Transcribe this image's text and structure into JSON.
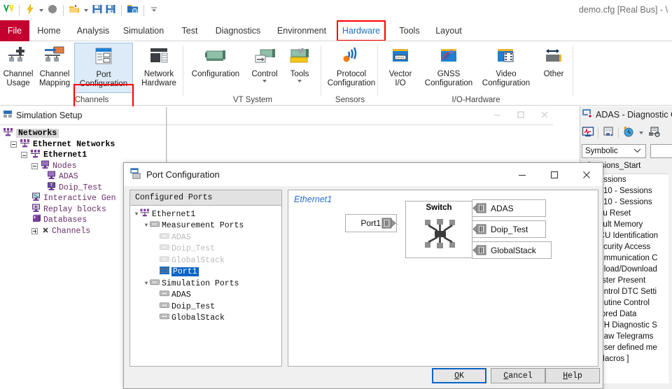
{
  "window": {
    "title": "demo.cfg [Real Bus] - \\"
  },
  "quick_access": {
    "icons": [
      "vector-logo-icon",
      "lightning-icon",
      "dropdown-caret-icon",
      "stop-circle-icon",
      "open-folder-icon",
      "dropdown-caret-icon",
      "save-icon",
      "save-as-icon",
      "config-folder-icon",
      "customize-qat-icon"
    ]
  },
  "ribbon": {
    "tabs": [
      {
        "label": "File",
        "active": false
      },
      {
        "label": "Home",
        "active": false
      },
      {
        "label": "Analysis",
        "active": false
      },
      {
        "label": "Simulation",
        "active": false
      },
      {
        "label": "Test",
        "active": false
      },
      {
        "label": "Diagnostics",
        "active": false
      },
      {
        "label": "Environment",
        "active": false
      },
      {
        "label": "Hardware",
        "active": true
      },
      {
        "label": "Tools",
        "active": false
      },
      {
        "label": "Layout",
        "active": false
      }
    ],
    "highlight_color": "#ff0000",
    "active_tab_color": "#1f6fc4",
    "file_tab_color": "#c3002f",
    "groups": [
      {
        "label": "Channels",
        "buttons": [
          {
            "label": "Channel\nUsage",
            "line1": "Channel",
            "line2": "Usage",
            "icon": "channel-usage-icon",
            "selected": false,
            "has_caret": false
          },
          {
            "label": "Channel\nMapping",
            "line1": "Channel",
            "line2": "Mapping",
            "icon": "channel-mapping-icon",
            "selected": false,
            "has_caret": false
          },
          {
            "label": "Port\nConfiguration",
            "line1": "Port",
            "line2": "Configuration",
            "icon": "port-configuration-icon",
            "selected": true,
            "has_caret": false
          },
          {
            "label": "Network\nHardware",
            "line1": "Network",
            "line2": "Hardware",
            "icon": "network-hardware-icon",
            "selected": false,
            "has_caret": false
          }
        ]
      },
      {
        "label": "VT System",
        "buttons": [
          {
            "line1": "Configuration",
            "line2": "",
            "icon": "vt-configuration-icon",
            "selected": false,
            "has_caret": false
          },
          {
            "line1": "Control",
            "line2": "",
            "icon": "vt-control-icon",
            "selected": false,
            "has_caret": true
          },
          {
            "line1": "Tools",
            "line2": "",
            "icon": "vt-tools-icon",
            "selected": false,
            "has_caret": true
          }
        ]
      },
      {
        "label": "Sensors",
        "buttons": [
          {
            "line1": "Protocol",
            "line2": "Configuration",
            "icon": "protocol-configuration-icon",
            "selected": false,
            "has_caret": false
          }
        ]
      },
      {
        "label": "I/O-Hardware",
        "buttons": [
          {
            "line1": "Vector",
            "line2": "I/O",
            "icon": "vector-io-icon",
            "selected": false,
            "has_caret": false
          },
          {
            "line1": "GNSS",
            "line2": "Configuration",
            "icon": "gnss-configuration-icon",
            "selected": false,
            "has_caret": false
          },
          {
            "line1": "Video",
            "line2": "Configuration",
            "icon": "video-configuration-icon",
            "selected": false,
            "has_caret": false
          },
          {
            "line1": "Other",
            "line2": "",
            "icon": "other-hardware-icon",
            "selected": false,
            "has_caret": false
          }
        ]
      }
    ]
  },
  "simulation_setup": {
    "title": "Simulation Setup",
    "icon": "simulation-setup-icon",
    "window_buttons": [
      "minimize",
      "maximize",
      "close"
    ],
    "tree": [
      {
        "label": "Networks",
        "indent": 0,
        "icon": "networks-icon",
        "expander": "none",
        "bold": true,
        "selected": true
      },
      {
        "label": "Ethernet Networks",
        "indent": 1,
        "icon": "networks-icon",
        "expander": "minus",
        "bold": true,
        "selected": false
      },
      {
        "label": "Ethernet1",
        "indent": 2,
        "icon": "networks-icon",
        "expander": "minus",
        "bold": true,
        "selected": false
      },
      {
        "label": "Nodes",
        "indent": 3,
        "icon": "node-icon",
        "expander": "minus",
        "bold": false,
        "selected": false
      },
      {
        "label": "ADAS",
        "indent": 4,
        "icon": "node-icon",
        "expander": "none",
        "bold": false,
        "selected": false
      },
      {
        "label": "Doip_Test",
        "indent": 4,
        "icon": "node-doip-icon",
        "expander": "none",
        "bold": false,
        "selected": false
      },
      {
        "label": "Interactive Gen",
        "indent": 3,
        "icon": "igen-icon",
        "expander": "none",
        "bold": false,
        "selected": false
      },
      {
        "label": "Replay blocks",
        "indent": 3,
        "icon": "replay-icon",
        "expander": "none",
        "bold": false,
        "selected": false
      },
      {
        "label": "Databases",
        "indent": 3,
        "icon": "database-icon",
        "expander": "none",
        "bold": false,
        "selected": false
      },
      {
        "label": "Channels",
        "indent": 3,
        "icon": "channels-icon",
        "expander": "plus",
        "bold": false,
        "selected": false
      }
    ]
  },
  "diagnostic_panel": {
    "title": "ADAS - Diagnostic C",
    "icon": "diagnostic-console-icon",
    "toolbar": [
      "trace-window-icon",
      "copy-to-icon",
      "history-icon",
      "history-caret-icon",
      "settings-icon"
    ],
    "mode_select": {
      "value": "Symbolic",
      "options": [
        "Symbolic"
      ]
    },
    "text_field_value": "",
    "session_label": "- Sessions_Start",
    "items": [
      {
        "label": "Sessions",
        "sub": false,
        "icon": "folder-service-icon"
      },
      {
        "label": "10 - Sessions",
        "sub": true,
        "icon": "request-icon"
      },
      {
        "label": "10 - Sessions",
        "sub": true,
        "icon": "request-icon"
      },
      {
        "label": "Ecu Reset",
        "sub": false,
        "icon": "folder-service-icon"
      },
      {
        "label": "Fault Memory",
        "sub": false,
        "icon": "folder-service-icon"
      },
      {
        "label": "ECU Identification",
        "sub": false,
        "icon": "folder-service-icon"
      },
      {
        "label": "Security Access",
        "sub": false,
        "icon": "folder-service-icon"
      },
      {
        "label": "Communication C",
        "sub": false,
        "icon": "folder-service-icon"
      },
      {
        "label": "Upload/Download",
        "sub": false,
        "icon": "folder-service-icon"
      },
      {
        "label": "Tester Present",
        "sub": false,
        "icon": "folder-service-icon"
      },
      {
        "label": "Control DTC Setti",
        "sub": false,
        "icon": "folder-service-icon"
      },
      {
        "label": "Routine Control",
        "sub": false,
        "icon": "folder-service-icon"
      },
      {
        "label": "Stored Data",
        "sub": false,
        "icon": "folder-service-icon"
      },
      {
        "label": "ETH Diagnostic S",
        "sub": false,
        "icon": "folder-service-icon"
      },
      {
        "label": "[ Raw Telegrams",
        "sub": false,
        "icon": "folder-service-icon"
      },
      {
        "label": "[ User defined me",
        "sub": false,
        "icon": "folder-service-icon"
      },
      {
        "label": "[ Macros ]",
        "sub": false,
        "icon": "folder-service-icon"
      }
    ]
  },
  "dialog": {
    "title": "Port Configuration",
    "icon": "port-configuration-icon",
    "controls": {
      "minimize": "–",
      "maximize": "☐",
      "close": "✕"
    },
    "left_panel_header": "Configured Ports",
    "tree": [
      {
        "label": "Ethernet1",
        "indent": 0,
        "icon": "network-icon",
        "arrow": "down",
        "dim": false,
        "selected": false
      },
      {
        "label": "Measurement Ports",
        "indent": 1,
        "icon": "port-icon",
        "arrow": "down",
        "dim": false,
        "selected": false
      },
      {
        "label": "ADAS",
        "indent": 2,
        "icon": "port-icon",
        "arrow": "none",
        "dim": true,
        "selected": false
      },
      {
        "label": "Doip_Test",
        "indent": 2,
        "icon": "port-icon",
        "arrow": "none",
        "dim": true,
        "selected": false
      },
      {
        "label": "GlobalStack",
        "indent": 2,
        "icon": "port-icon",
        "arrow": "none",
        "dim": true,
        "selected": false
      },
      {
        "label": "Port1",
        "indent": 2,
        "icon": "port-icon",
        "arrow": "none",
        "dim": false,
        "selected": true
      },
      {
        "label": "Simulation Ports",
        "indent": 1,
        "icon": "port-icon",
        "arrow": "down",
        "dim": false,
        "selected": false
      },
      {
        "label": "ADAS",
        "indent": 2,
        "icon": "port-icon",
        "arrow": "none",
        "dim": false,
        "selected": false
      },
      {
        "label": "Doip_Test",
        "indent": 2,
        "icon": "port-icon",
        "arrow": "none",
        "dim": false,
        "selected": false
      },
      {
        "label": "GlobalStack",
        "indent": 2,
        "icon": "port-icon",
        "arrow": "none",
        "dim": false,
        "selected": false
      }
    ],
    "diagram": {
      "network_label": "Ethernet1",
      "port_node": "Port1",
      "switch_label": "Switch",
      "nodes": [
        "ADAS",
        "Doip_Test",
        "GlobalStack"
      ]
    },
    "buttons": [
      {
        "id": "ok",
        "pre": "",
        "mnemonic": "O",
        "post": "K",
        "default": true
      },
      {
        "id": "cancel",
        "pre": "",
        "mnemonic": "C",
        "post": "ancel",
        "default": false
      },
      {
        "id": "help",
        "pre": "",
        "mnemonic": "H",
        "post": "elp",
        "default": false
      }
    ]
  }
}
